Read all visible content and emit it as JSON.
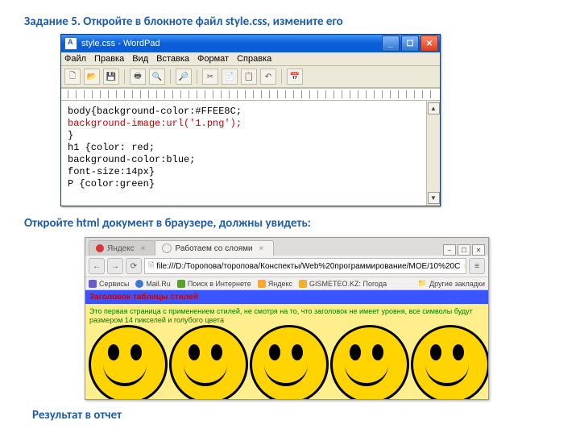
{
  "heading1": "Задание 5. Откройте в блокноте файл style.css, измените его",
  "heading2": "Откройте html документ в браузере, должны увидеть:",
  "heading3": "Результат в отчет",
  "wordpad": {
    "title": "style.css - WordPad",
    "menu": {
      "file": "Файл",
      "edit": "Правка",
      "view": "Вид",
      "insert": "Вставка",
      "format": "Формат",
      "help": "Справка"
    },
    "code": {
      "l1": "body{background-color:#FFEE8C;",
      "l2": "background-image:url('1.png');",
      "l3": "}",
      "l4": "h1 {color: red;",
      "l5": "background-color:blue;",
      "l6": "font-size:14px}",
      "l7": "P {color:green}"
    }
  },
  "browser": {
    "tabs": {
      "t1": "Яндекс",
      "t2": "Работаем со слоями"
    },
    "url": "file:///D:/Торопова/торопова/Конспекты/Web%20программирование/МОЕ/10%20С",
    "bookmarks": {
      "apps": "Сервисы",
      "mail": "Mail.Ru",
      "search": "Поиск в Интернете",
      "yandex": "Яндекс",
      "gis": "GISMETEO.KZ: Погода",
      "other": "Другие закладки"
    },
    "page": {
      "h1": "Заголовок таблицы стилей",
      "p": "Это первая страница с применением стилей, не смотря на то, что заголовок не имеет уровня, все символы будут размером 14 пикселей и голубого цвета"
    }
  }
}
